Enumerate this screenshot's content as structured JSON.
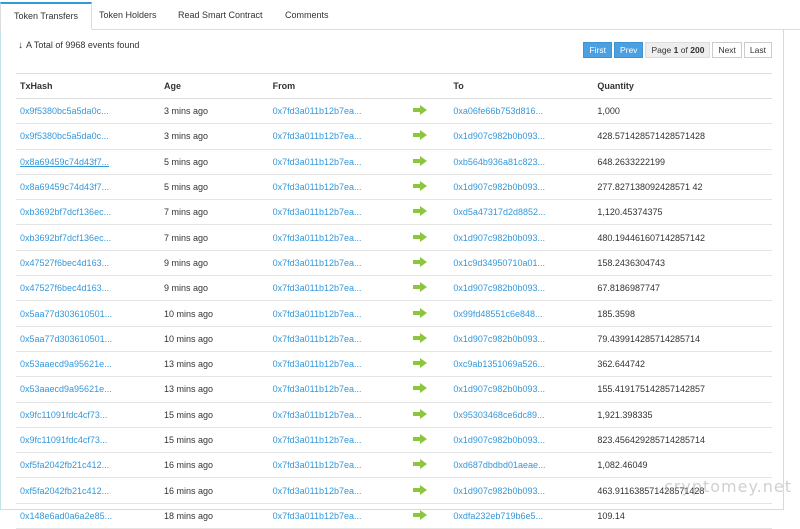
{
  "tabs": [
    {
      "label": "Token Transfers",
      "active": true
    },
    {
      "label": "Token Holders",
      "active": false
    },
    {
      "label": "Read Smart Contract",
      "active": false
    },
    {
      "label": "Comments",
      "active": false
    }
  ],
  "summary": "A Total of 9968 events found",
  "pagination": {
    "first": "First",
    "prev": "Prev",
    "page_prefix": "Page",
    "page_current": "1",
    "page_of": "of",
    "page_total": "200",
    "next": "Next",
    "last": "Last"
  },
  "columns": {
    "txhash": "TxHash",
    "age": "Age",
    "from": "From",
    "to": "To",
    "quantity": "Quantity"
  },
  "rows": [
    {
      "tx": "0x9f5380bc5a5da0c...",
      "age": "3 mins ago",
      "from": "0x7fd3a011b12b7ea...",
      "to": "0xa06fe66b753d816...",
      "qty": "1,000"
    },
    {
      "tx": "0x9f5380bc5a5da0c...",
      "age": "3 mins ago",
      "from": "0x7fd3a011b12b7ea...",
      "to": "0x1d907c982b0b093...",
      "qty": "428.571428571428571428"
    },
    {
      "tx": "0x8a69459c74d43f7...",
      "age": "5 mins ago",
      "from": "0x7fd3a011b12b7ea...",
      "to": "0xb564b936a81c823...",
      "qty": "648.2633222199"
    },
    {
      "tx": "0x8a69459c74d43f7...",
      "age": "5 mins ago",
      "from": "0x7fd3a011b12b7ea...",
      "to": "0x1d907c982b0b093...",
      "qty": "277.827138092428571 42"
    },
    {
      "tx": "0xb3692bf7dcf136ec...",
      "age": "7 mins ago",
      "from": "0x7fd3a011b12b7ea...",
      "to": "0xd5a47317d2d8852...",
      "qty": "1,120.45374375"
    },
    {
      "tx": "0xb3692bf7dcf136ec...",
      "age": "7 mins ago",
      "from": "0x7fd3a011b12b7ea...",
      "to": "0x1d907c982b0b093...",
      "qty": "480.194461607142857142"
    },
    {
      "tx": "0x47527f6bec4d163...",
      "age": "9 mins ago",
      "from": "0x7fd3a011b12b7ea...",
      "to": "0x1c9d34950710a01...",
      "qty": "158.2436304743"
    },
    {
      "tx": "0x47527f6bec4d163...",
      "age": "9 mins ago",
      "from": "0x7fd3a011b12b7ea...",
      "to": "0x1d907c982b0b093...",
      "qty": "67.8186987747"
    },
    {
      "tx": "0x5aa77d303610501...",
      "age": "10 mins ago",
      "from": "0x7fd3a011b12b7ea...",
      "to": "0x99fd48551c6e848...",
      "qty": "185.3598"
    },
    {
      "tx": "0x5aa77d303610501...",
      "age": "10 mins ago",
      "from": "0x7fd3a011b12b7ea...",
      "to": "0x1d907c982b0b093...",
      "qty": "79.439914285714285714"
    },
    {
      "tx": "0x53aaecd9a95621e...",
      "age": "13 mins ago",
      "from": "0x7fd3a011b12b7ea...",
      "to": "0xc9ab1351069a526...",
      "qty": "362.644742"
    },
    {
      "tx": "0x53aaecd9a95621e...",
      "age": "13 mins ago",
      "from": "0x7fd3a011b12b7ea...",
      "to": "0x1d907c982b0b093...",
      "qty": "155.419175142857142857"
    },
    {
      "tx": "0x9fc11091fdc4cf73...",
      "age": "15 mins ago",
      "from": "0x7fd3a011b12b7ea...",
      "to": "0x95303468ce6dc89...",
      "qty": "1,921.398335"
    },
    {
      "tx": "0x9fc11091fdc4cf73...",
      "age": "15 mins ago",
      "from": "0x7fd3a011b12b7ea...",
      "to": "0x1d907c982b0b093...",
      "qty": "823.456429285714285714"
    },
    {
      "tx": "0xf5fa2042fb21c412...",
      "age": "16 mins ago",
      "from": "0x7fd3a011b12b7ea...",
      "to": "0xd687dbdbd01aeae...",
      "qty": "1,082.46049"
    },
    {
      "tx": "0xf5fa2042fb21c412...",
      "age": "16 mins ago",
      "from": "0x7fd3a011b12b7ea...",
      "to": "0x1d907c982b0b093...",
      "qty": "463.911638571428571428"
    },
    {
      "tx": "0x148e6ad0a6a2e85...",
      "age": "18 mins ago",
      "from": "0x7fd3a011b12b7ea...",
      "to": "0xdfa232eb719b6e5...",
      "qty": "109.14"
    }
  ],
  "watermark": "cryptomey.net",
  "colors": {
    "link": "#3498db",
    "active_tab_border": "#3498db",
    "pager_blue": "#4aa0e0",
    "arrow_green": "#8cc63f"
  }
}
